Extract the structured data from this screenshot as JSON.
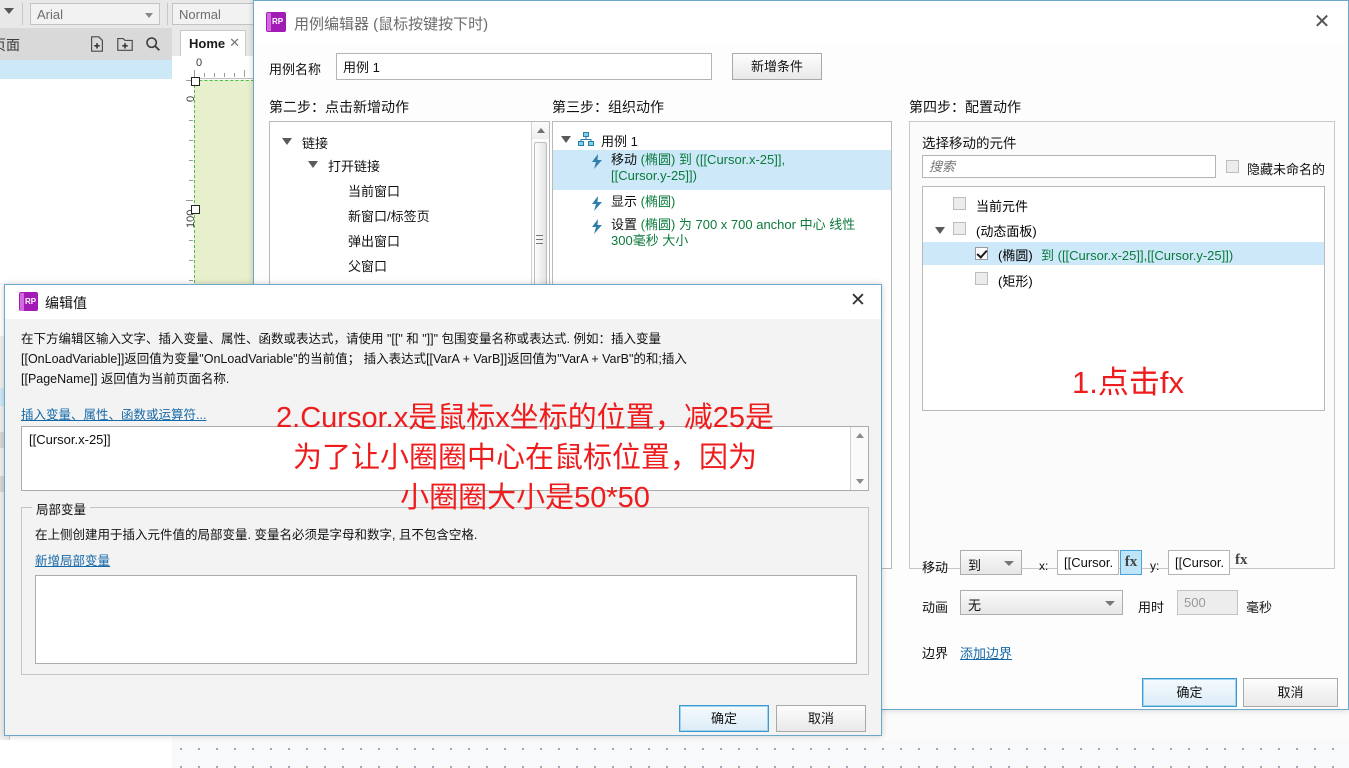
{
  "background_app": {
    "toolbar": {
      "font_family": "Arial",
      "font_style": "Normal"
    },
    "sidebar": {
      "title": "页面"
    },
    "canvas_tab": {
      "label": "Home",
      "close": "✕"
    },
    "ruler": {
      "h_marks": [
        "0"
      ],
      "v_marks": [
        "0",
        "100"
      ]
    }
  },
  "usecase_dialog": {
    "title": "用例编辑器 (鼠标按键按下时)",
    "logo_text": "RP",
    "close": "✕",
    "name_label": "用例名称",
    "name_value": "用例 1",
    "add_condition_button": "新增条件",
    "step2_title": "第二步：点击新增动作",
    "step3_title": "第三步：组织动作",
    "step4_title": "第四步：配置动作",
    "action_tree": [
      {
        "label": "链接",
        "level": 0,
        "expanded": true
      },
      {
        "label": "打开链接",
        "level": 1,
        "expanded": true
      },
      {
        "label": "当前窗口",
        "level": 2,
        "expanded": false
      },
      {
        "label": "新窗口/标签页",
        "level": 2,
        "expanded": false
      },
      {
        "label": "弹出窗口",
        "level": 2,
        "expanded": false
      },
      {
        "label": "父窗口",
        "level": 2,
        "expanded": false
      }
    ],
    "organize": {
      "root_label": "用例 1",
      "actions": [
        {
          "verb": "移动",
          "rest": " (椭圆) 到 ([[Cursor.x-25]],",
          "rest2": "[[Cursor.y-25]])",
          "selected": true
        },
        {
          "verb": "显示",
          "rest": " (椭圆)",
          "rest2": "",
          "selected": false
        },
        {
          "verb": "设置",
          "rest": " (椭圆)  为 700 x 700 anchor 中心 线性",
          "rest2": "300毫秒 大小",
          "selected": false
        }
      ]
    },
    "configure": {
      "section_label": "选择移动的元件",
      "search_placeholder": "搜索",
      "hide_unnamed_label": "隐藏未命名的",
      "hide_unnamed_checked": false,
      "element_tree": [
        {
          "label": "当前元件",
          "level": 1,
          "checked": false,
          "selected": false,
          "expandable": false,
          "value": ""
        },
        {
          "label": "(动态面板)",
          "level": 1,
          "checked": false,
          "selected": false,
          "expandable": true,
          "value": ""
        },
        {
          "label": "(椭圆)",
          "level": 2,
          "checked": true,
          "selected": true,
          "expandable": false,
          "value": "到 ([[Cursor.x-25]],[[Cursor.y-25]])"
        },
        {
          "label": "(矩形)",
          "level": 2,
          "checked": false,
          "selected": false,
          "expandable": false,
          "value": ""
        }
      ],
      "move_label": "移动",
      "move_mode": "到",
      "x_label": "x:",
      "x_value": "[[Cursor.",
      "x_fx": "fx",
      "y_label": "y:",
      "y_value": "[[Cursor.",
      "y_fx": "fx",
      "anim_label": "动画",
      "anim_value": "无",
      "duration_label": "用时",
      "duration_value": "500",
      "ms_label": "毫秒",
      "boundary_label": "边界",
      "add_boundary_link": "添加边界"
    },
    "ok_button": "确定",
    "cancel_button": "取消"
  },
  "editvalue_dialog": {
    "title": "编辑值",
    "logo_text": "RP",
    "close": "✕",
    "help_line1": "在下方编辑区输入文字、插入变量、属性、函数或表达式，请使用 \"[[\" 和 \"]]\" 包围变量名称或表达式. 例如：插入变量",
    "help_line2": "[[OnLoadVariable]]返回值为变量\"OnLoadVariable\"的当前值； 插入表达式[[VarA + VarB]]返回值为\"VarA + VarB\"的和;插入",
    "help_line3": "[[PageName]] 返回值为当前页面名称.",
    "insert_link": "插入变量、属性、函数或运算符...",
    "expression_value": "[[Cursor.x-25]]",
    "local_vars_legend": "局部变量",
    "local_vars_help": "在上侧创建用于插入元件值的局部变量. 变量名必须是字母和数字, 且不包含空格.",
    "add_local_var_link": "新增局部变量",
    "ok_button": "确定",
    "cancel_button": "取消"
  },
  "annotations": {
    "note1": "1.点击fx",
    "note2_line1": "2.Cursor.x是鼠标x坐标的位置，减25是",
    "note2_line2": "为了让小圈圈中心在鼠标位置，因为",
    "note2_line3": "小圈圈大小是50*50",
    "color": "#ee1c1c"
  }
}
